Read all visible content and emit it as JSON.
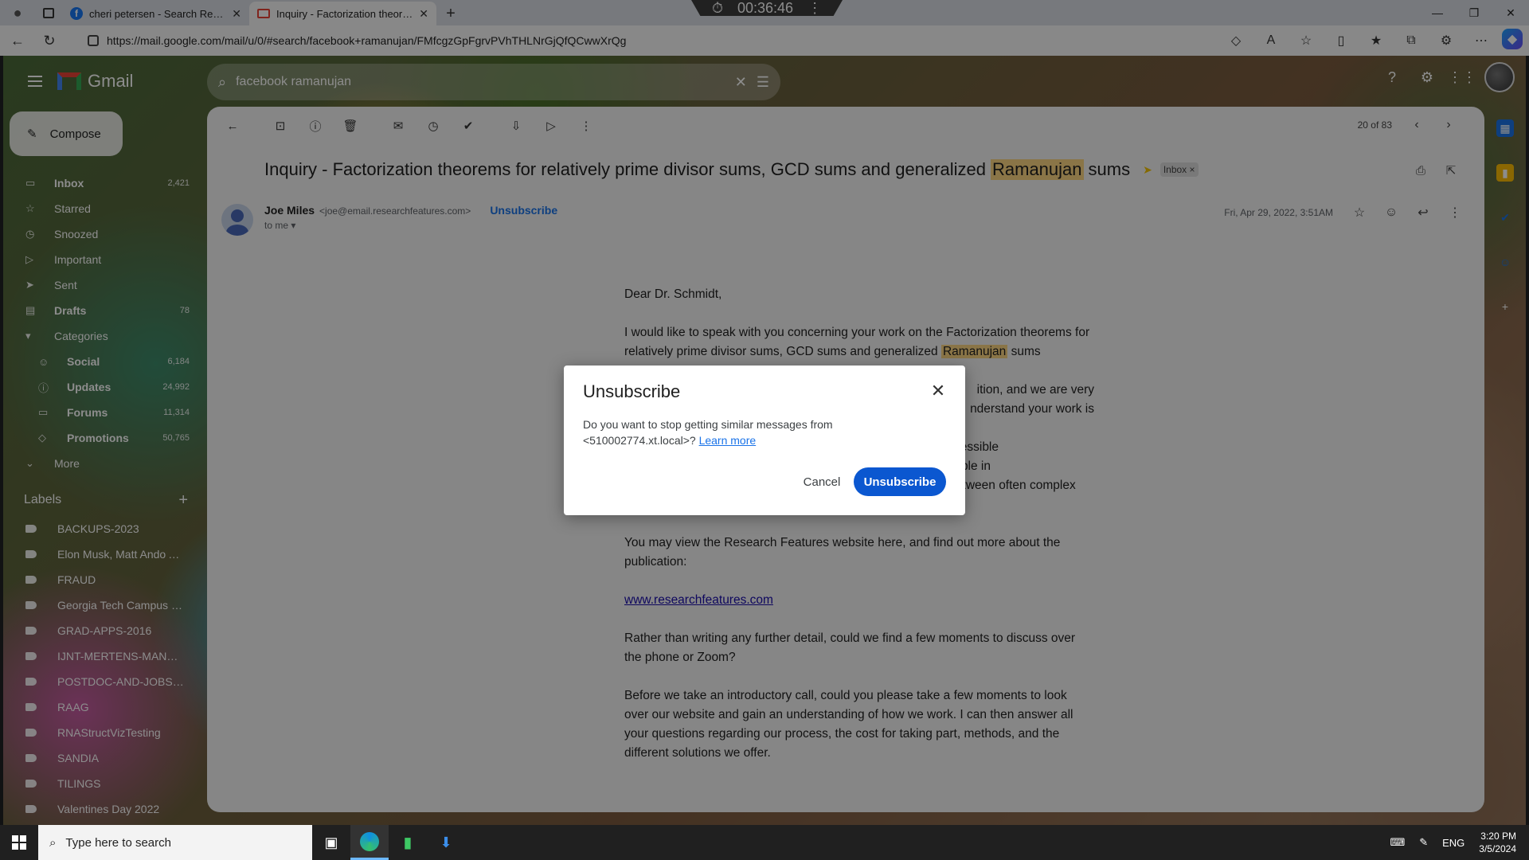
{
  "browser": {
    "tabs": [
      {
        "title": "cheri petersen - Search Results |",
        "favicon": "facebook-icon"
      },
      {
        "title": "Inquiry - Factorization theorems",
        "favicon": "gmail-icon"
      }
    ],
    "timer": "00:36:46",
    "url": "https://mail.google.com/mail/u/0/#search/facebook+ramanujan/FMfcgzGpFgrvPVhTHLNrGjQfQCwwXrQg"
  },
  "gmail": {
    "brand": "Gmail",
    "search_value": "facebook ramanujan",
    "compose_label": "Compose",
    "nav": [
      {
        "label": "Inbox",
        "count": "2,421",
        "icon": "inbox-icon",
        "bold": true
      },
      {
        "label": "Starred",
        "count": "",
        "icon": "star-icon"
      },
      {
        "label": "Snoozed",
        "count": "",
        "icon": "clock-icon"
      },
      {
        "label": "Important",
        "count": "",
        "icon": "important-icon"
      },
      {
        "label": "Sent",
        "count": "",
        "icon": "send-icon"
      },
      {
        "label": "Drafts",
        "count": "78",
        "icon": "draft-icon",
        "bold": true
      },
      {
        "label": "Categories",
        "count": "",
        "icon": "label-icon"
      }
    ],
    "categories": [
      {
        "label": "Social",
        "count": "6,184",
        "icon": "people-icon"
      },
      {
        "label": "Updates",
        "count": "24,992",
        "icon": "info-icon"
      },
      {
        "label": "Forums",
        "count": "11,314",
        "icon": "forum-icon"
      },
      {
        "label": "Promotions",
        "count": "50,765",
        "icon": "tag-icon"
      }
    ],
    "more_label": "More",
    "labels_heading": "Labels",
    "labels": [
      "BACKUPS-2023",
      "Elon Musk, Matt Ando A...",
      "FRAUD",
      "Georgia Tech Campus E...",
      "GRAD-APPS-2016",
      "IJNT-MERTENS-MANUS...",
      "POSTDOC-AND-JOBS-...",
      "RAAG",
      "RNAStructVizTesting",
      "SANDIA",
      "TILINGS",
      "Valentines Day 2022"
    ],
    "pager": "20 of 83"
  },
  "message": {
    "subject_before": "Inquiry - Factorization theorems for relatively prime divisor sums, GCD sums and generalized",
    "subject_highlight": "Ramanujan",
    "subject_after": "sums",
    "inbox_chip": "Inbox",
    "sender_name": "Joe Miles",
    "sender_email": "<joe@email.researchfeatures.com>",
    "unsubscribe_link": "Unsubscribe",
    "to_me": "to me",
    "date": "Fri, Apr 29, 2022, 3:51AM",
    "body": {
      "greeting": "Dear Dr. Schmidt,",
      "p1_before": "I would like to speak with you concerning your work on the Factorization theorems for relatively prime divisor sums, GCD sums and generalized",
      "p1_highlight": "Ramanujan",
      "p1_after": "sums",
      "p2_fragment_1": "ition, and we are very",
      "p2_fragment_2": "nderstand your work is",
      "p3_fragment_1": "rch more accessible",
      "p3_fragment_2": "cally to people in",
      "p3_rest": "industry, government, and the public to help bridge the gap between often complex bodies of research, and these audiences.",
      "p4": "You may view the Research Features website here, and find out more about the publication:",
      "link": "www.researchfeatures.com",
      "p5": "Rather than writing any further detail, could we find a few moments to discuss over the phone or Zoom?",
      "p6": "Before we take an introductory call, could you please take a few moments to look over our website and gain an understanding of how we work. I can then answer all your questions regarding our process, the cost for taking part, methods, and the different solutions we offer."
    }
  },
  "dialog": {
    "title": "Unsubscribe",
    "text": "Do you want to stop getting similar messages from <510002774.xt.local>?",
    "learn_more": "Learn more",
    "cancel": "Cancel",
    "confirm": "Unsubscribe"
  },
  "taskbar": {
    "search_placeholder": "Type here to search",
    "lang": "ENG",
    "time": "3:20 PM",
    "date": "3/5/2024"
  }
}
